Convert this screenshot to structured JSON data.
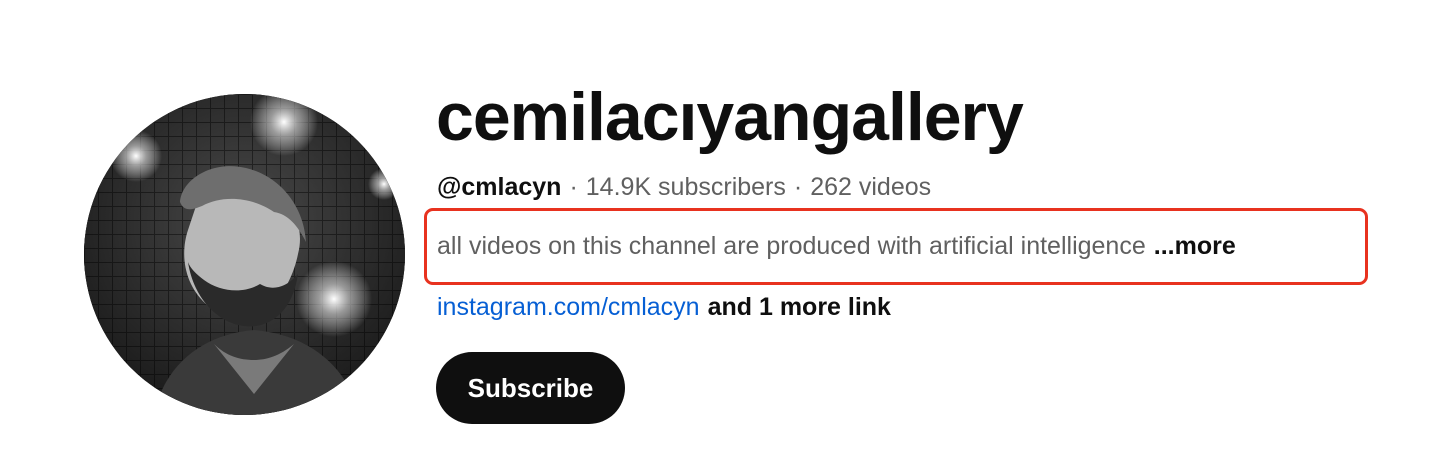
{
  "channel": {
    "name": "cemilacıyangallery",
    "handle": "@cmlacyn",
    "separator": "·",
    "subscribers": "14.9K subscribers",
    "videos": "262 videos",
    "description": "all videos on this channel are produced with artificial intelligence",
    "more_label": "...more",
    "primary_link": "instagram.com/cmlacyn",
    "more_links_label": "and 1 more link",
    "subscribe_label": "Subscribe"
  },
  "colors": {
    "highlight_box": "#e8321f",
    "link": "#065fd4",
    "button_bg": "#0f0f0f",
    "secondary_text": "#606060"
  },
  "icons": {
    "avatar": "channel-avatar-photo"
  }
}
